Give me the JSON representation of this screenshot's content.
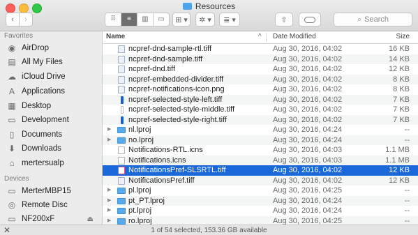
{
  "window": {
    "title": "Resources"
  },
  "toolbar": {
    "back_icon": "‹",
    "forward_icon": "›",
    "view_modes": [
      "⠿",
      "≡",
      "▥",
      "▭"
    ],
    "arrange_icon": "⊞ ▾",
    "action_icon": "✲ ▾",
    "sort_icon": "≣ ▾",
    "share_icon": "⇧",
    "search_placeholder": "Search",
    "search_icon": "⌕"
  },
  "sidebar": {
    "favorites_header": "Favorites",
    "favorites": [
      {
        "label": "AirDrop",
        "icon": "◉"
      },
      {
        "label": "All My Files",
        "icon": "▤"
      },
      {
        "label": "iCloud Drive",
        "icon": "☁"
      },
      {
        "label": "Applications",
        "icon": "A"
      },
      {
        "label": "Desktop",
        "icon": "▦"
      },
      {
        "label": "Development",
        "icon": "▭"
      },
      {
        "label": "Documents",
        "icon": "▯"
      },
      {
        "label": "Downloads",
        "icon": "⬇"
      },
      {
        "label": "mertersualp",
        "icon": "⌂"
      }
    ],
    "devices_header": "Devices",
    "devices": [
      {
        "label": "MerterMBP15",
        "icon": "▭"
      },
      {
        "label": "Remote Disc",
        "icon": "◎"
      },
      {
        "label": "NF200xF",
        "icon": "▭",
        "eject": "⏏"
      }
    ]
  },
  "columns": {
    "name": "Name",
    "sort_indicator": "^",
    "date": "Date Modified",
    "size": "Size"
  },
  "files": [
    {
      "name": "ncpref-dnd-sample-rtl.tiff",
      "date": "Aug 30, 2016, 04:02",
      "size": "16 KB",
      "kind": "image",
      "folder": false
    },
    {
      "name": "ncpref-dnd-sample.tiff",
      "date": "Aug 30, 2016, 04:02",
      "size": "14 KB",
      "kind": "image",
      "folder": false
    },
    {
      "name": "ncpref-dnd.tiff",
      "date": "Aug 30, 2016, 04:02",
      "size": "12 KB",
      "kind": "image",
      "folder": false
    },
    {
      "name": "ncpref-embedded-divider.tiff",
      "date": "Aug 30, 2016, 04:02",
      "size": "8 KB",
      "kind": "image",
      "folder": false
    },
    {
      "name": "ncpref-notifications-icon.png",
      "date": "Aug 30, 2016, 04:02",
      "size": "8 KB",
      "kind": "image",
      "folder": false
    },
    {
      "name": "ncpref-selected-style-left.tiff",
      "date": "Aug 30, 2016, 04:02",
      "size": "7 KB",
      "kind": "strip-blue",
      "folder": false
    },
    {
      "name": "ncpref-selected-style-middle.tiff",
      "date": "Aug 30, 2016, 04:02",
      "size": "7 KB",
      "kind": "strip-white",
      "folder": false
    },
    {
      "name": "ncpref-selected-style-right.tiff",
      "date": "Aug 30, 2016, 04:02",
      "size": "7 KB",
      "kind": "strip-blue",
      "folder": false
    },
    {
      "name": "nl.lproj",
      "date": "Aug 30, 2016, 04:24",
      "size": "--",
      "kind": "folder",
      "folder": true
    },
    {
      "name": "no.lproj",
      "date": "Aug 30, 2016, 04:24",
      "size": "--",
      "kind": "folder",
      "folder": true
    },
    {
      "name": "Notifications-RTL.icns",
      "date": "Aug 30, 2016, 04:03",
      "size": "1.1 MB",
      "kind": "icns",
      "folder": false
    },
    {
      "name": "Notifications.icns",
      "date": "Aug 30, 2016, 04:03",
      "size": "1.1 MB",
      "kind": "icns",
      "folder": false
    },
    {
      "name": "NotificationsPref-SLSRTL.tiff",
      "date": "Aug 30, 2016, 04:02",
      "size": "12 KB",
      "kind": "sel",
      "folder": false,
      "selected": true
    },
    {
      "name": "NotificationsPref.tiff",
      "date": "Aug 30, 2016, 04:02",
      "size": "12 KB",
      "kind": "image",
      "folder": false
    },
    {
      "name": "pl.lproj",
      "date": "Aug 30, 2016, 04:25",
      "size": "--",
      "kind": "folder",
      "folder": true
    },
    {
      "name": "pt_PT.lproj",
      "date": "Aug 30, 2016, 04:24",
      "size": "--",
      "kind": "folder",
      "folder": true
    },
    {
      "name": "pt.lproj",
      "date": "Aug 30, 2016, 04:24",
      "size": "--",
      "kind": "folder",
      "folder": true
    },
    {
      "name": "ro.lproj",
      "date": "Aug 30, 2016, 04:25",
      "size": "--",
      "kind": "folder",
      "folder": true
    }
  ],
  "status": {
    "close_icon": "✕",
    "text": "1 of 54 selected, 153.36 GB available"
  }
}
